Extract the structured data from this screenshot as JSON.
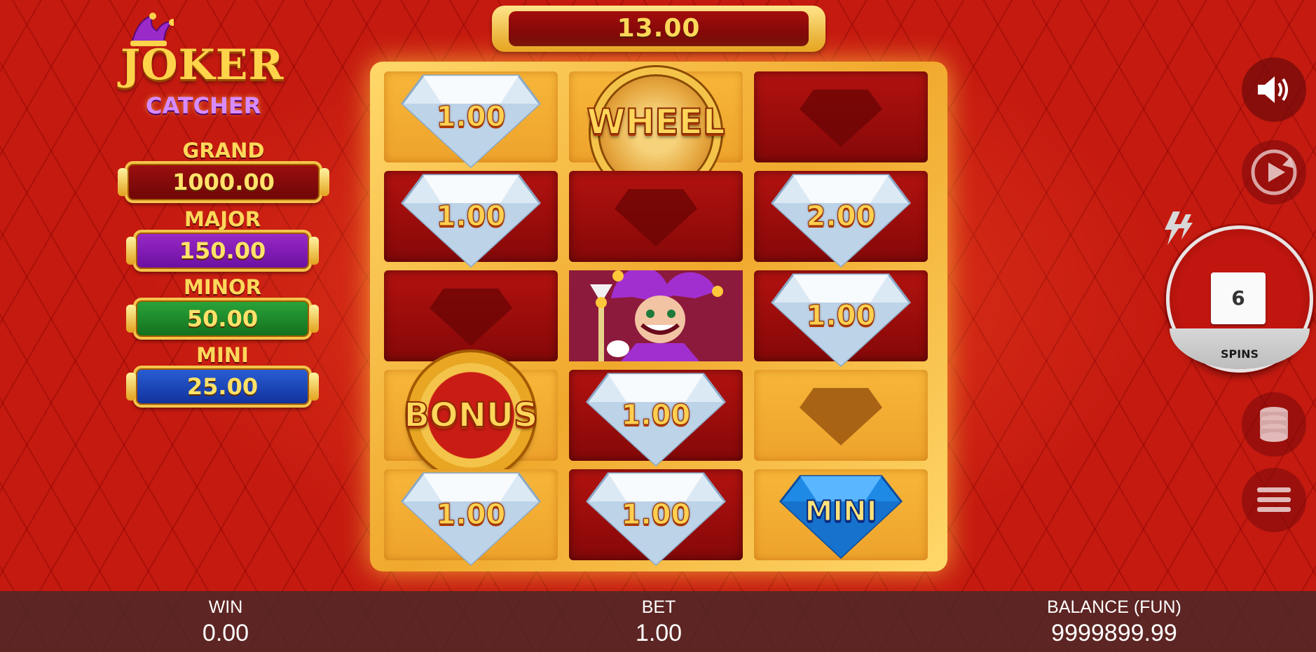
{
  "logo": {
    "line1": "JOKER",
    "line2": "CATCHER"
  },
  "jackpots": [
    {
      "label": "GRAND",
      "value": "1000.00"
    },
    {
      "label": "MAJOR",
      "value": "150.00"
    },
    {
      "label": "MINOR",
      "value": "50.00"
    },
    {
      "label": "MINI",
      "value": "25.00"
    }
  ],
  "top_win": "13.00",
  "reels": {
    "r0c0": "1.00",
    "r0c1": "WHEEL",
    "r1c0": "1.00",
    "r1c2": "2.00",
    "r2c2": "1.00",
    "r3c0": "BONUS",
    "r3c1": "1.00",
    "r4c0": "1.00",
    "r4c1": "1.00",
    "r4c2": "MINI"
  },
  "spins": {
    "count": "6",
    "label": "SPINS"
  },
  "footer": {
    "win_label": "WIN",
    "win_value": "0.00",
    "bet_label": "BET",
    "bet_value": "1.00",
    "balance_label": "BALANCE (FUN)",
    "balance_value": "9999899.99"
  },
  "colors": {
    "gold": "#f4c44a",
    "red_bg": "#c51a10",
    "grand": "#7e0909",
    "major": "#7d1cb3",
    "minor": "#1f8a2b",
    "mini": "#1c47bd"
  },
  "icons": [
    "joker-hat-icon",
    "speaker-icon",
    "autoplay-icon",
    "turbo-lightning-icon",
    "coin-stack-icon",
    "menu-icon"
  ]
}
